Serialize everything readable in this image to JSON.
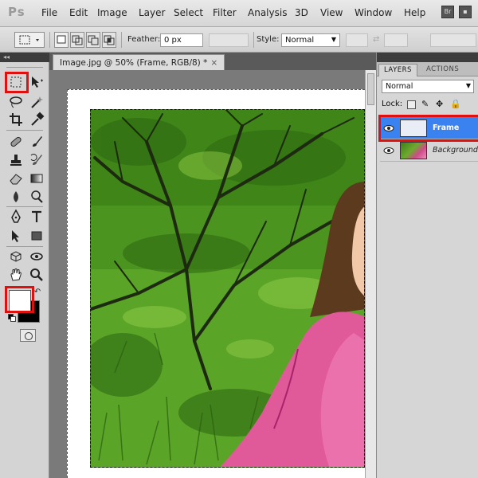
{
  "app": {
    "logo": "Ps"
  },
  "menu": {
    "items": [
      "File",
      "Edit",
      "Image",
      "Layer",
      "Select",
      "Filter",
      "Analysis",
      "3D",
      "View",
      "Window",
      "Help"
    ]
  },
  "options": {
    "feather_label": "Feather:",
    "feather_value": "0 px",
    "style_label": "Style:",
    "style_value": "Normal"
  },
  "document": {
    "tab_title": "Image.jpg @ 50% (Frame, RGB/8) *",
    "close_glyph": "×"
  },
  "layers_panel": {
    "tabs": [
      "LAYERS",
      "ACTIONS"
    ],
    "blend_mode": "Normal",
    "lock_label": "Lock:",
    "layers": [
      {
        "name": "Frame",
        "visible": true,
        "selected": true
      },
      {
        "name": "Background",
        "visible": true,
        "selected": false
      }
    ]
  },
  "colors": {
    "accent_highlight": "#e01010",
    "selected_layer": "#3a82f0",
    "foreground": "#ffffff",
    "background": "#000000"
  },
  "icons": {
    "tools": [
      "rectangular-marquee-icon",
      "move-icon",
      "lasso-icon",
      "magic-wand-icon",
      "crop-icon",
      "eyedropper-icon",
      "spot-healing-icon",
      "brush-icon",
      "clone-stamp-icon",
      "history-brush-icon",
      "eraser-icon",
      "gradient-icon",
      "blur-icon",
      "dodge-icon",
      "pen-icon",
      "type-icon",
      "path-selection-icon",
      "rectangle-shape-icon",
      "3d-rotate-icon",
      "3d-orbit-icon",
      "hand-icon",
      "zoom-icon"
    ]
  }
}
